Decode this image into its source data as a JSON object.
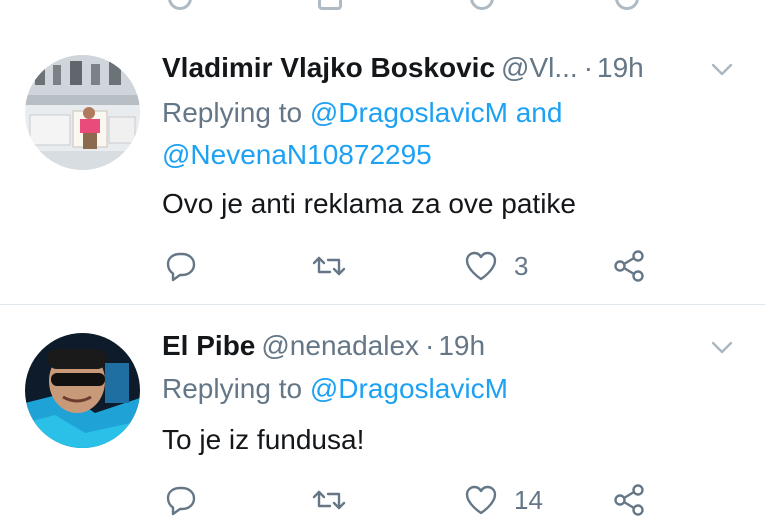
{
  "colors": {
    "accent": "#1da1f2",
    "secondary_text": "#657786",
    "primary_text": "#14171a",
    "divider": "#e1e8ed"
  },
  "tweets": [
    {
      "name": "Vladimir Vlajko Boskovic",
      "handle": "@Vl...",
      "time": "19h",
      "reply_prefix": "Replying to",
      "mention1": "@DragoslavicM",
      "conjunction": "and",
      "mention2": "@NevenaN10872295",
      "text": "Ovo je anti reklama za ove patike",
      "likes": "3",
      "icons": [
        "reply-icon",
        "retweet-icon",
        "heart-icon",
        "share-icon",
        "chevron-down-icon"
      ]
    },
    {
      "name": "El Pibe",
      "handle": "@nenadalex",
      "time": "19h",
      "reply_prefix": "Replying to",
      "mention1": "@DragoslavicM",
      "text": "To je iz fundusa!",
      "likes": "14",
      "icons": [
        "reply-icon",
        "retweet-icon",
        "heart-icon",
        "share-icon",
        "chevron-down-icon"
      ]
    }
  ],
  "separator": "·"
}
